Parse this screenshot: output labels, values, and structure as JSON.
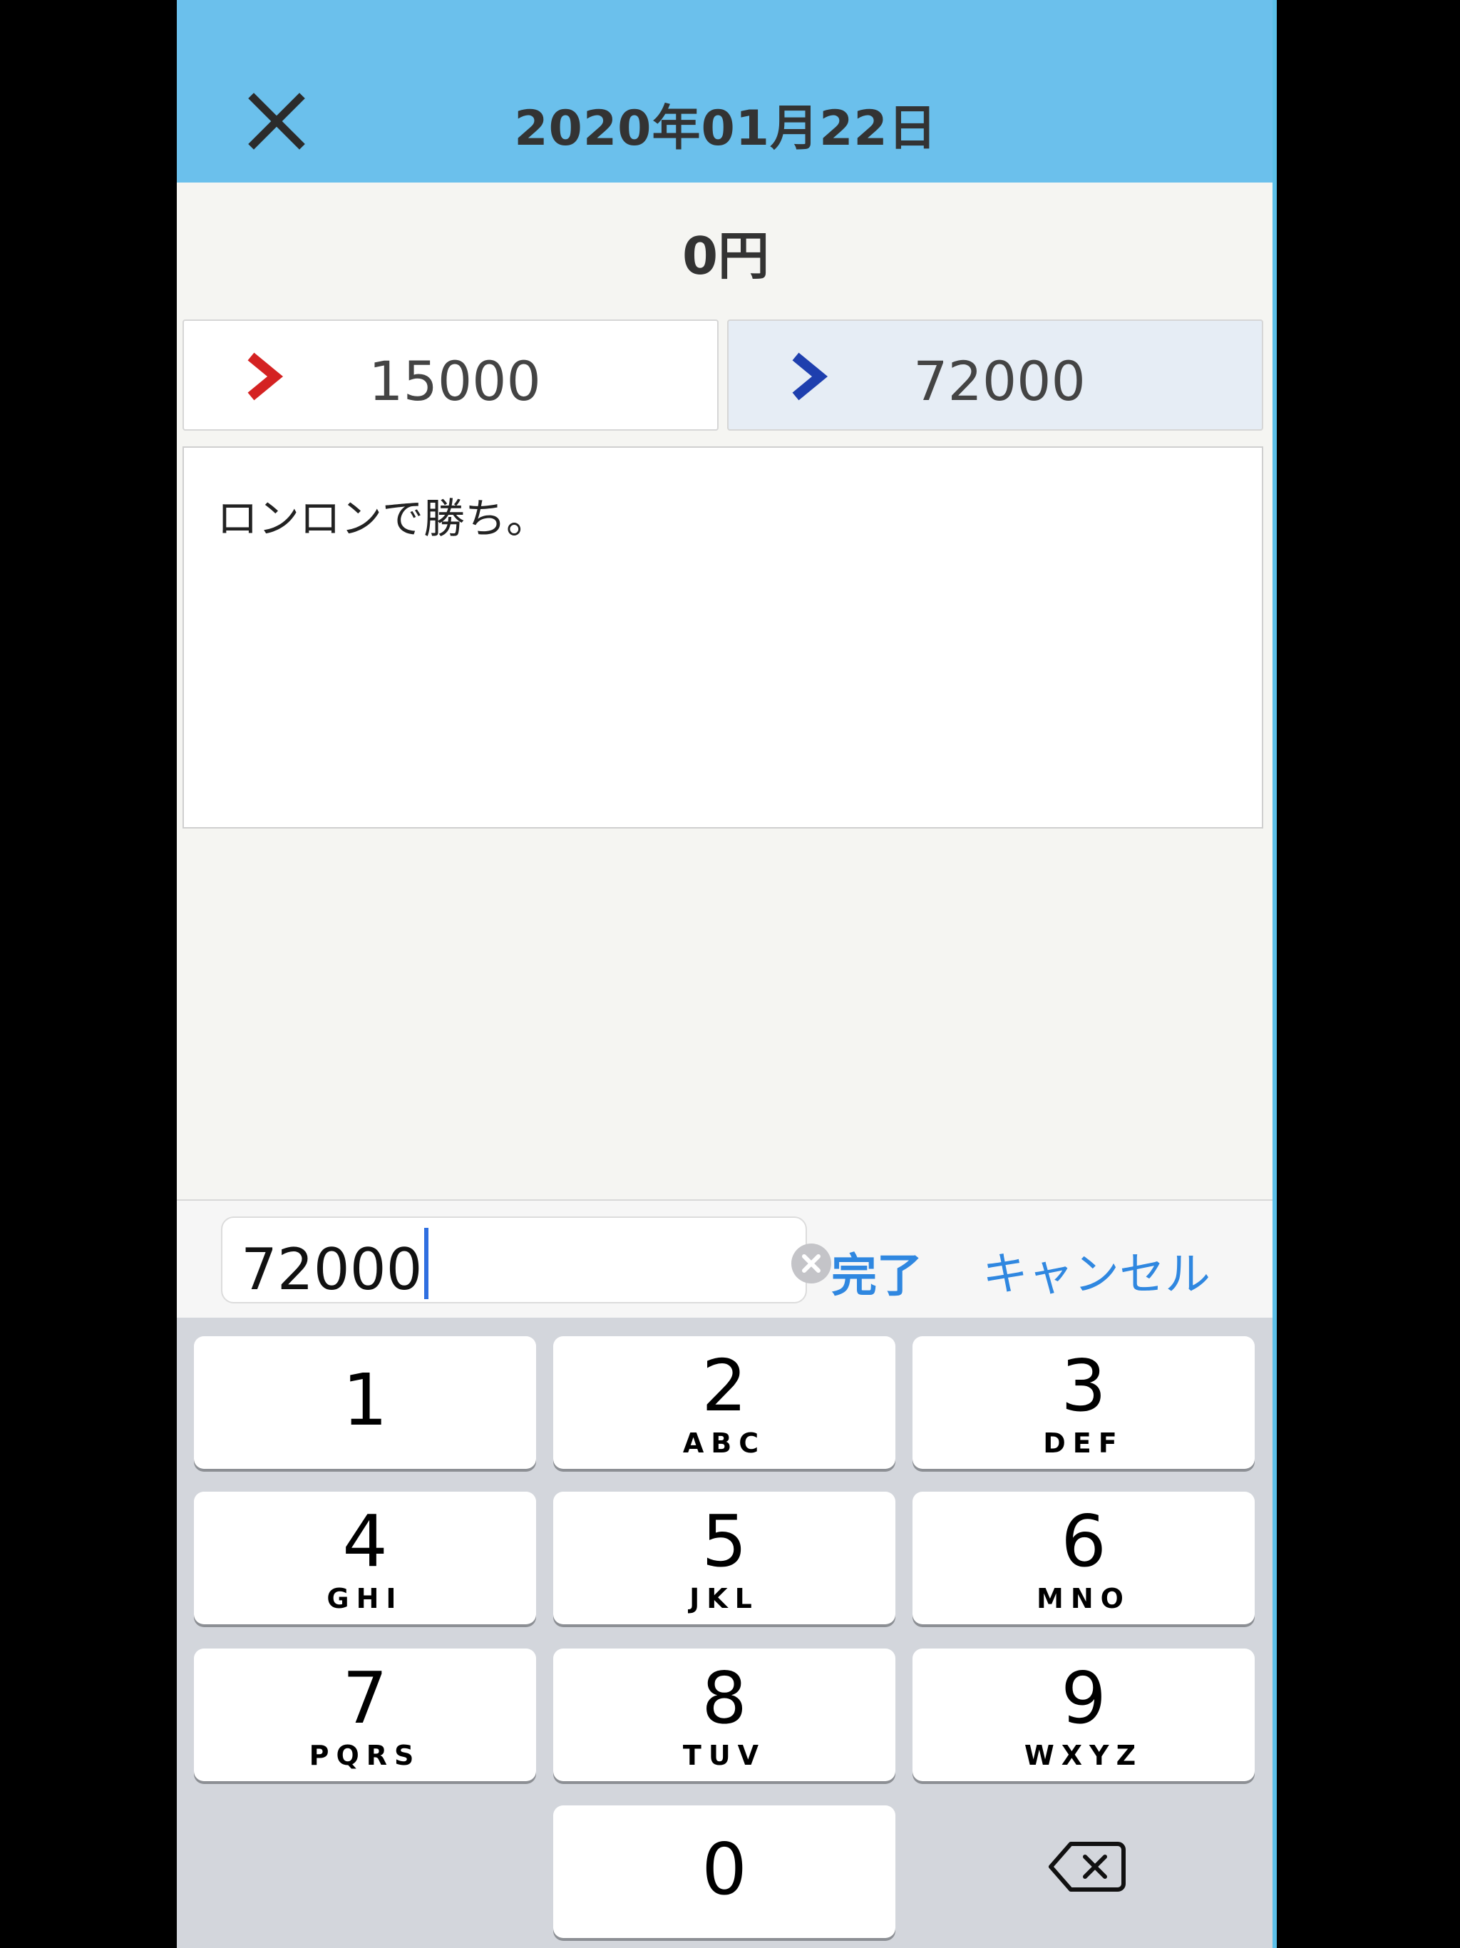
{
  "header": {
    "title": "2020年01月22日",
    "close_icon": "close-icon"
  },
  "total": "0円",
  "amounts": {
    "left": {
      "value": "15000",
      "chevron_color": "#d42222"
    },
    "right": {
      "value": "72000",
      "chevron_color": "#1e3fae"
    }
  },
  "memo": {
    "text": "ロンロンで勝ち。"
  },
  "input_bar": {
    "value": "72000",
    "done_label": "完了",
    "cancel_label": "キャンセル"
  },
  "keypad": {
    "keys": [
      {
        "digit": "1",
        "letters": ""
      },
      {
        "digit": "2",
        "letters": "ABC"
      },
      {
        "digit": "3",
        "letters": "DEF"
      },
      {
        "digit": "4",
        "letters": "GHI"
      },
      {
        "digit": "5",
        "letters": "JKL"
      },
      {
        "digit": "6",
        "letters": "MNO"
      },
      {
        "digit": "7",
        "letters": "PQRS"
      },
      {
        "digit": "8",
        "letters": "TUV"
      },
      {
        "digit": "9",
        "letters": "WXYZ"
      },
      {
        "digit": "0",
        "letters": ""
      }
    ],
    "backspace_icon": "backspace-icon"
  },
  "colors": {
    "header_bg": "#6bc0ec",
    "accent_blue": "#2f87e0"
  }
}
